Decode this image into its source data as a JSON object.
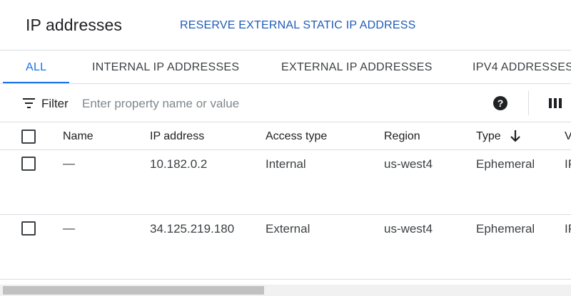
{
  "header": {
    "title": "IP addresses",
    "reserve_label": "RESERVE EXTERNAL STATIC IP ADDRESS"
  },
  "tabs": [
    {
      "label": "ALL",
      "active": true
    },
    {
      "label": "INTERNAL IP ADDRESSES",
      "active": false
    },
    {
      "label": "EXTERNAL IP ADDRESSES",
      "active": false
    },
    {
      "label": "IPV4 ADDRESSES",
      "active": false
    }
  ],
  "filter": {
    "label": "Filter",
    "placeholder": "Enter property name or value",
    "icon": "filter-list-icon"
  },
  "toolbar_icons": {
    "help": "help-icon",
    "help_glyph": "?",
    "columns": "column-display-icon"
  },
  "table": {
    "columns": [
      "Name",
      "IP address",
      "Access type",
      "Region",
      "Type",
      "V"
    ],
    "sorted_column": "Type",
    "sort_direction": "descending",
    "rows": [
      {
        "name": "—",
        "ip": "10.182.0.2",
        "access": "Internal",
        "region": "us-west4",
        "type": "Ephemeral",
        "version": "IP"
      },
      {
        "name": "—",
        "ip": "34.125.219.180",
        "access": "External",
        "region": "us-west4",
        "type": "Ephemeral",
        "version": "IP"
      }
    ]
  },
  "colors": {
    "accent": "#1a73e8",
    "text": "#202124",
    "divider": "#dadce0"
  }
}
